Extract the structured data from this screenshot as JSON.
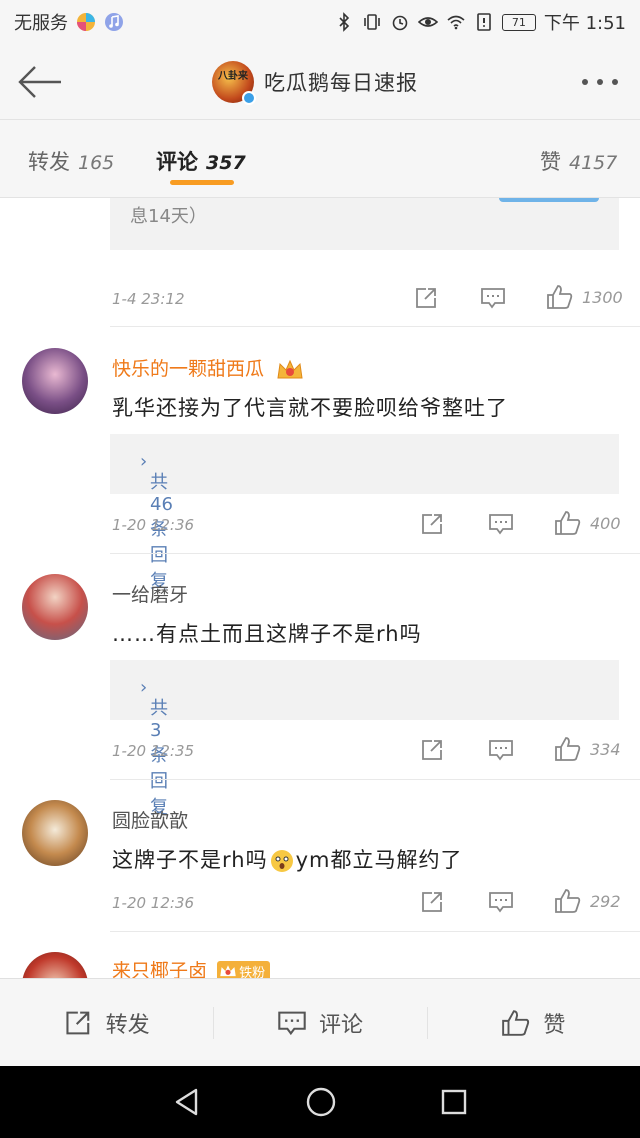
{
  "status_bar": {
    "carrier": "无服务",
    "battery": "71",
    "time": "下午 1:51"
  },
  "app_bar": {
    "title": "吃瓜鹅每日速报",
    "avatar_text": "八卦来"
  },
  "tabs": [
    {
      "label": "转发",
      "count": "165"
    },
    {
      "label": "评论",
      "count": "357"
    },
    {
      "label": "赞",
      "count": "4157"
    }
  ],
  "top_partial": {
    "text": "息14天）",
    "time": "1-4 23:12",
    "likes": "1300"
  },
  "comments": [
    {
      "name": "快乐的一颗甜西瓜",
      "text": "乳华还接为了代言就不要脸呗给爷整吐了",
      "replies": "共46条回复",
      "time": "1-20 12:36",
      "likes": "400"
    },
    {
      "name": "一给磨牙",
      "text": "……有点土而且这牌子不是rh吗",
      "replies": "共3条回复",
      "time": "1-20 12:35",
      "likes": "334"
    },
    {
      "name": "圆脸歆歆",
      "text_a": "这牌子不是rh吗",
      "text_b": "ym都立马解约了",
      "time": "1-20 12:36",
      "likes": "292"
    },
    {
      "name": "来只椰子卤",
      "badge": "铁粉"
    }
  ],
  "bottom_bar": {
    "repost": "转发",
    "comment": "评论",
    "like": "赞"
  },
  "colors": {
    "accent": "#f89c22",
    "link": "#5a7fb5",
    "vip_name": "#ef7a1a"
  }
}
